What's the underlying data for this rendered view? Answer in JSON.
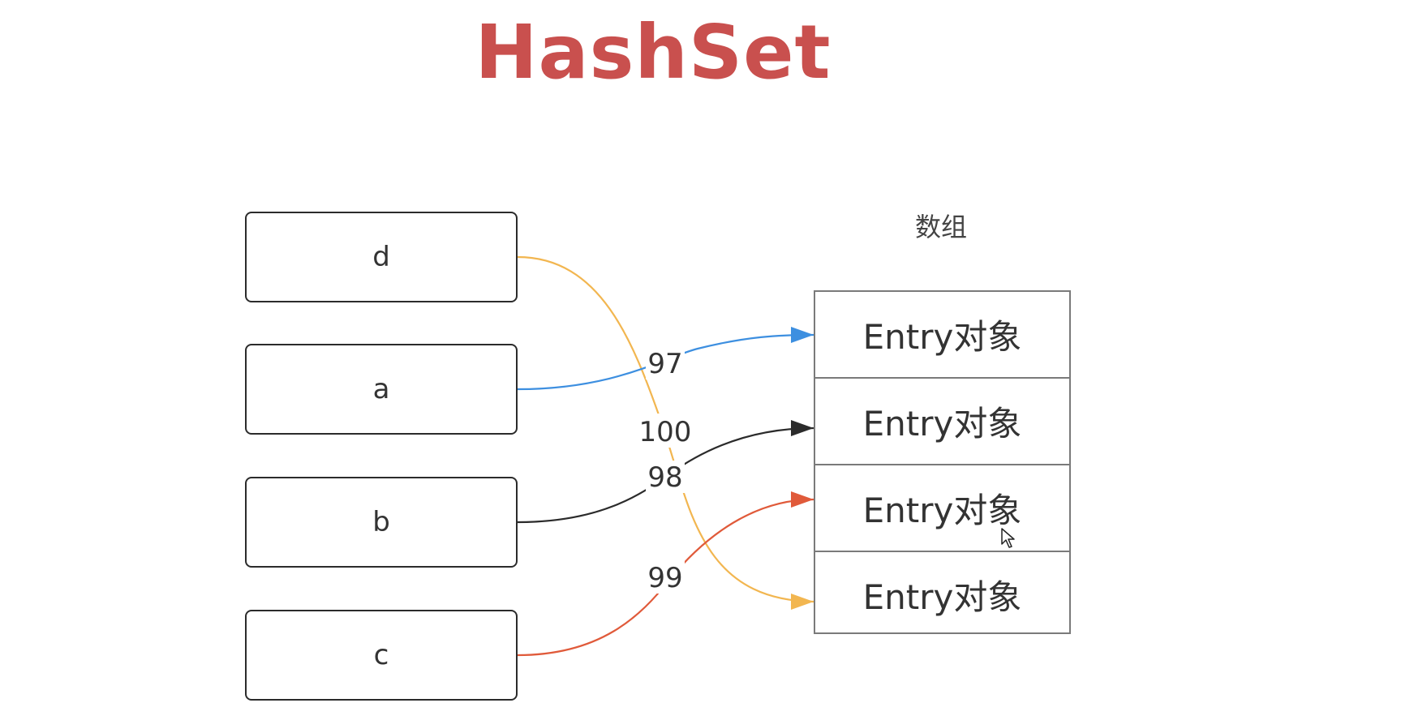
{
  "title": "HashSet",
  "keys": [
    {
      "label": "d"
    },
    {
      "label": "a"
    },
    {
      "label": "b"
    },
    {
      "label": "c"
    }
  ],
  "array": {
    "caption": "数组",
    "cells": [
      "Entry对象",
      "Entry对象",
      "Entry对象",
      "Entry对象"
    ]
  },
  "links": [
    {
      "from": "d",
      "to_cell": 4,
      "label": "100",
      "color": "#f2b650"
    },
    {
      "from": "a",
      "to_cell": 1,
      "label": "97",
      "color": "#3d8fe0"
    },
    {
      "from": "b",
      "to_cell": 2,
      "label": "98",
      "color": "#2b2b2b"
    },
    {
      "from": "c",
      "to_cell": 3,
      "label": "99",
      "color": "#e05a3a"
    }
  ]
}
